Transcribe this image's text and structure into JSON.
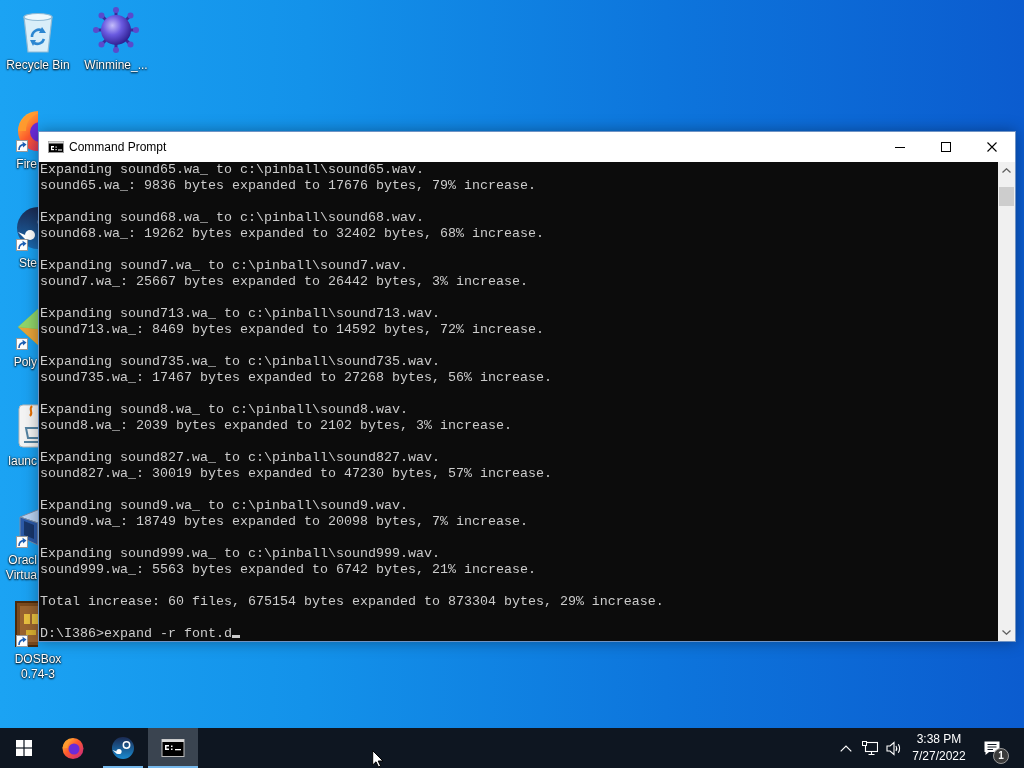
{
  "desktop": {
    "icons": [
      {
        "kind": "recycle-bin",
        "shortcut": false,
        "clipped": false,
        "label_cut": false,
        "label": [
          "Recycle Bin"
        ]
      },
      {
        "kind": "firefox",
        "shortcut": true,
        "clipped": true,
        "label_cut": true,
        "label": [
          "Fire"
        ]
      },
      {
        "kind": "steam",
        "shortcut": true,
        "clipped": true,
        "label_cut": true,
        "label": [
          "Ste"
        ]
      },
      {
        "kind": "poly",
        "shortcut": true,
        "clipped": true,
        "label_cut": true,
        "label": [
          "Poly"
        ]
      },
      {
        "kind": "java",
        "shortcut": false,
        "clipped": true,
        "label_cut": true,
        "label": [
          "launc"
        ]
      },
      {
        "kind": "virtualbox",
        "shortcut": true,
        "clipped": true,
        "label_cut": true,
        "label": [
          "Oracl",
          "Virtua"
        ]
      },
      {
        "kind": "dosbox",
        "shortcut": true,
        "clipped": true,
        "label_cut": false,
        "label": [
          "DOSBox",
          "0.74-3"
        ]
      },
      {
        "kind": "mine",
        "shortcut": false,
        "clipped": false,
        "label_cut": false,
        "label": [
          "Winmine_..."
        ]
      }
    ]
  },
  "window": {
    "title": "Command Prompt",
    "console": {
      "blocks": [
        {
          "expanding": "Expanding sound65.wa_ to c:\\pinball\\sound65.wav.",
          "result": "sound65.wa_: 9836 bytes expanded to 17676 bytes, 79% increase."
        },
        {
          "expanding": "Expanding sound68.wa_ to c:\\pinball\\sound68.wav.",
          "result": "sound68.wa_: 19262 bytes expanded to 32402 bytes, 68% increase."
        },
        {
          "expanding": "Expanding sound7.wa_ to c:\\pinball\\sound7.wav.",
          "result": "sound7.wa_: 25667 bytes expanded to 26442 bytes, 3% increase."
        },
        {
          "expanding": "Expanding sound713.wa_ to c:\\pinball\\sound713.wav.",
          "result": "sound713.wa_: 8469 bytes expanded to 14592 bytes, 72% increase."
        },
        {
          "expanding": "Expanding sound735.wa_ to c:\\pinball\\sound735.wav.",
          "result": "sound735.wa_: 17467 bytes expanded to 27268 bytes, 56% increase."
        },
        {
          "expanding": "Expanding sound8.wa_ to c:\\pinball\\sound8.wav.",
          "result": "sound8.wa_: 2039 bytes expanded to 2102 bytes, 3% increase."
        },
        {
          "expanding": "Expanding sound827.wa_ to c:\\pinball\\sound827.wav.",
          "result": "sound827.wa_: 30019 bytes expanded to 47230 bytes, 57% increase."
        },
        {
          "expanding": "Expanding sound9.wa_ to c:\\pinball\\sound9.wav.",
          "result": "sound9.wa_: 18749 bytes expanded to 20098 bytes, 7% increase."
        },
        {
          "expanding": "Expanding sound999.wa_ to c:\\pinball\\sound999.wav.",
          "result": "sound999.wa_: 5563 bytes expanded to 6742 bytes, 21% increase."
        }
      ],
      "summary": "Total increase: 60 files, 675154 bytes expanded to 873304 bytes, 29% increase.",
      "prompt": "D:\\I386>expand -r font.d"
    }
  },
  "taskbar": {
    "apps": [
      {
        "kind": "firefox",
        "running": false,
        "selected": false
      },
      {
        "kind": "steam",
        "running": true,
        "selected": false
      },
      {
        "kind": "cmd",
        "running": true,
        "selected": true
      }
    ],
    "tray": {
      "time": "3:38 PM",
      "date": "7/27/2022",
      "notifications": "1"
    }
  }
}
